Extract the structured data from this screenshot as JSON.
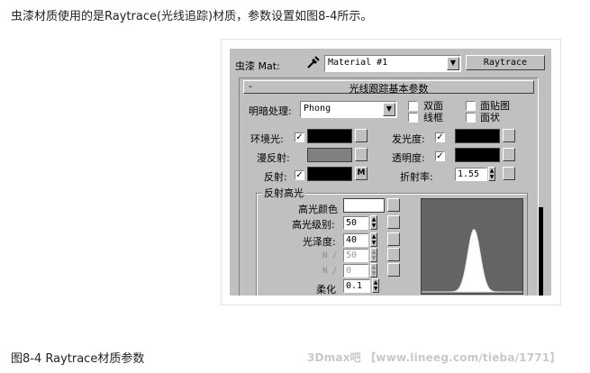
{
  "intro_text": "虫漆材质使用的是Raytrace(光线追踪)材质，参数设置如图8-4所示。",
  "caption": "图8-4 Raytrace材质参数",
  "watermark": "3Dmax吧 【www.lineeg.com/tieba/1771】",
  "ui": {
    "mat_label": "虫漆 Mat:",
    "material_name": "Material #1",
    "material_type_button": "Raytrace",
    "rollout": {
      "toggle": "-",
      "title": "光线跟踪基本参数"
    },
    "shading": {
      "label": "明暗处理:",
      "value": "Phong",
      "options": [
        {
          "label": "双面",
          "checked": false
        },
        {
          "label": "面贴图",
          "checked": false
        },
        {
          "label": "线框",
          "checked": false
        },
        {
          "label": "面状",
          "checked": false
        }
      ]
    },
    "ambient_label": "环境光:",
    "diffuse_label": "漫反射:",
    "reflect_label": "反射:",
    "reflect_map_button": "M",
    "luminosity_label": "发光度:",
    "transparency_label": "透明度:",
    "ior_label": "折射率:",
    "ior_value": "1.55",
    "colors": {
      "ambient": "#000000",
      "diffuse": "#808080",
      "reflect": "#000000",
      "luminosity": "#000000",
      "transparency": "#000000",
      "specular": "#ffffff"
    },
    "specular_group": {
      "title": "反射高光",
      "specular_color_label": "高光颜色",
      "specular_level_label": "高光级别:",
      "specular_level": "50",
      "glossiness_label": "光泽度:",
      "glossiness": "40",
      "n1_label": "N /",
      "n1_value": "50",
      "n2_label": "N /",
      "n2_value": "0",
      "soften_label": "柔化",
      "soften": "0.1"
    },
    "highlight_curve": {
      "peak_fraction": 0.66
    }
  }
}
